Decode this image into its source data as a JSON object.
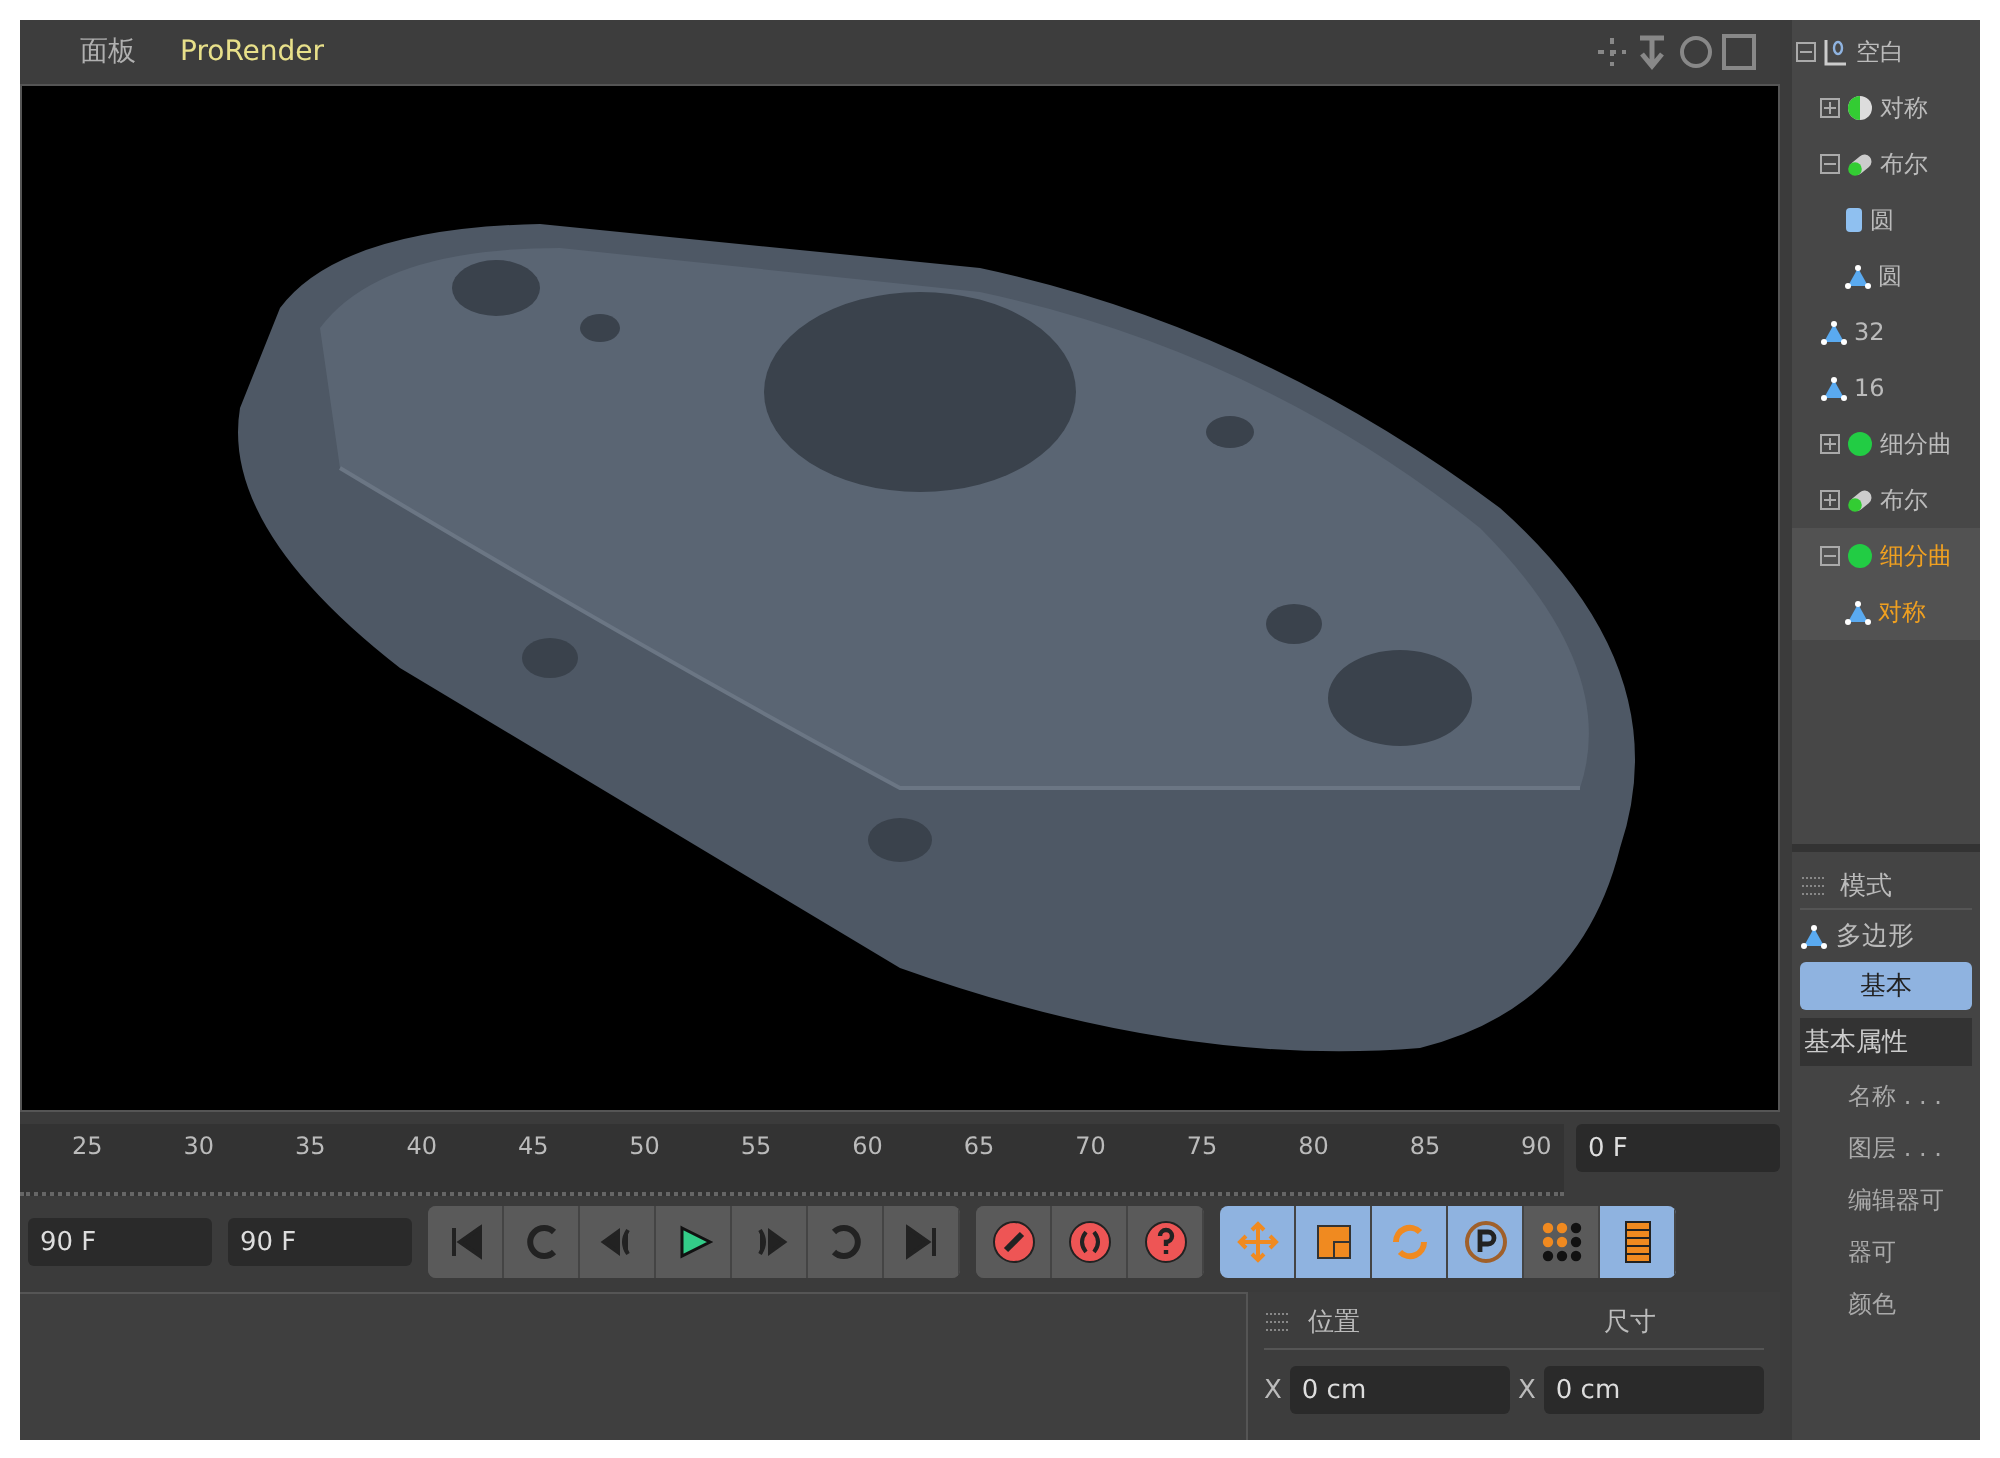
{
  "menu": [
    {
      "label": "面板",
      "highlighted": false
    },
    {
      "label": "ProRender",
      "highlighted": true
    }
  ],
  "object_tree": [
    {
      "label": "空白",
      "kind": "null",
      "expanded": true,
      "selected": false,
      "children": [
        {
          "label": "对称",
          "kind": "symmetry",
          "expanded": false,
          "selected": false
        },
        {
          "label": "布尔",
          "kind": "boole",
          "expanded": true,
          "selected": false,
          "children": [
            {
              "label": "圆",
              "kind": "cylinder",
              "selected": false
            },
            {
              "label": "圆",
              "kind": "polygon",
              "selected": false
            }
          ]
        },
        {
          "label": "32",
          "kind": "polygon",
          "selected": false
        },
        {
          "label": "16",
          "kind": "polygon",
          "selected": false
        },
        {
          "label": "细分曲",
          "kind": "subdivision",
          "expanded": false,
          "selected": false
        },
        {
          "label": "布尔",
          "kind": "boole",
          "expanded": false,
          "selected": false
        },
        {
          "label": "细分曲",
          "kind": "subdivision",
          "expanded": true,
          "selected": true,
          "children": [
            {
              "label": "对称",
              "kind": "polygon",
              "selected": true
            }
          ]
        }
      ]
    }
  ],
  "attributes": {
    "header": "模式",
    "object_name": "多边形",
    "tabs": [
      {
        "label": "基本",
        "selected": true
      }
    ],
    "section": "基本属性",
    "rows": [
      "名称 . . .",
      "图层 . . .",
      "编辑器可",
      "器可",
      "颜色"
    ]
  },
  "timeline": {
    "ticks": [
      "25",
      "30",
      "35",
      "40",
      "45",
      "50",
      "55",
      "60",
      "65",
      "70",
      "75",
      "80",
      "85",
      "90"
    ],
    "frame_field": "0 F"
  },
  "transport": {
    "fields": [
      "90 F",
      "90 F"
    ],
    "buttons": [
      {
        "kind": "first"
      },
      {
        "kind": "prev-key"
      },
      {
        "kind": "prev-frame"
      },
      {
        "kind": "play"
      },
      {
        "kind": "next-frame"
      },
      {
        "kind": "next-key"
      },
      {
        "kind": "last"
      }
    ],
    "record": [
      {
        "kind": "key"
      },
      {
        "kind": "autokey"
      },
      {
        "kind": "help"
      }
    ],
    "modes": [
      {
        "kind": "move",
        "on": true
      },
      {
        "kind": "scale",
        "on": true
      },
      {
        "kind": "rotate",
        "on": true
      },
      {
        "kind": "param",
        "on": true
      },
      {
        "kind": "points",
        "on": false
      },
      {
        "kind": "film",
        "on": true
      }
    ]
  },
  "coordinates": {
    "headers": [
      "位置",
      "尺寸"
    ],
    "fields": [
      {
        "axis": "X",
        "value": "0 cm"
      },
      {
        "axis": "X",
        "value": "0 cm"
      }
    ]
  }
}
